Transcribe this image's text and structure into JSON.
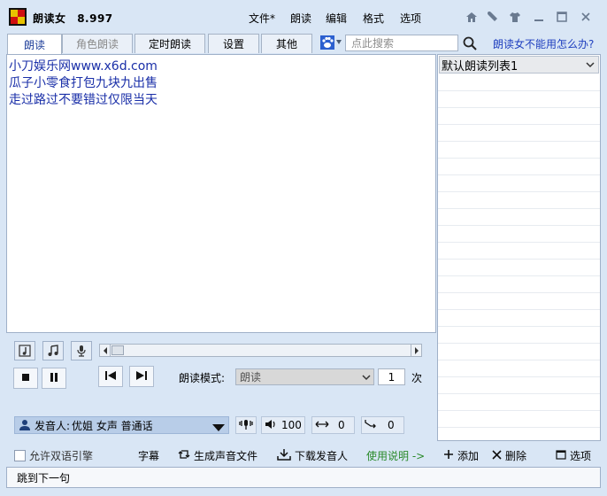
{
  "title": {
    "app_name": "朗读女",
    "version": "8.997"
  },
  "menu": [
    "文件*",
    "朗读",
    "编辑",
    "格式",
    "选项"
  ],
  "tabs": [
    {
      "label": "朗读",
      "state": "active"
    },
    {
      "label": "角色朗读",
      "state": "disabled"
    },
    {
      "label": "定时朗读",
      "state": "normal"
    },
    {
      "label": "设置",
      "state": "normal"
    },
    {
      "label": "其他",
      "state": "normal"
    }
  ],
  "search": {
    "placeholder": "点此搜索"
  },
  "help_link": "朗读女不能用怎么办?",
  "text_lines": [
    "小刀娱乐网www.x6d.com",
    "瓜子小零食打包九块九出售",
    "走过路过不要错过仅限当天"
  ],
  "playlist": {
    "selected": "默认朗读列表1"
  },
  "mode": {
    "label": "朗读模式:",
    "value": "朗读"
  },
  "repeat": {
    "value": "1",
    "unit": "次"
  },
  "speaker": {
    "label": "发音人:",
    "value": "优姐 女声 普通话"
  },
  "params": {
    "volume": "100",
    "speed": "0",
    "pitch": "0"
  },
  "options": {
    "allow_dual_engine": "允许双语引擎",
    "subtitle": "字幕"
  },
  "actions": {
    "generate_audio": "生成声音文件",
    "download_voice": "下载发音人",
    "instructions": "使用说明 ->",
    "add": "添加",
    "delete": "删除",
    "options": "选项"
  },
  "status": "跳到下一句",
  "colors": {
    "link": "#1f3fbf",
    "text": "#1a2fa8",
    "green_link": "#2a8a2a",
    "accent_bg": "#d9e6f5"
  }
}
